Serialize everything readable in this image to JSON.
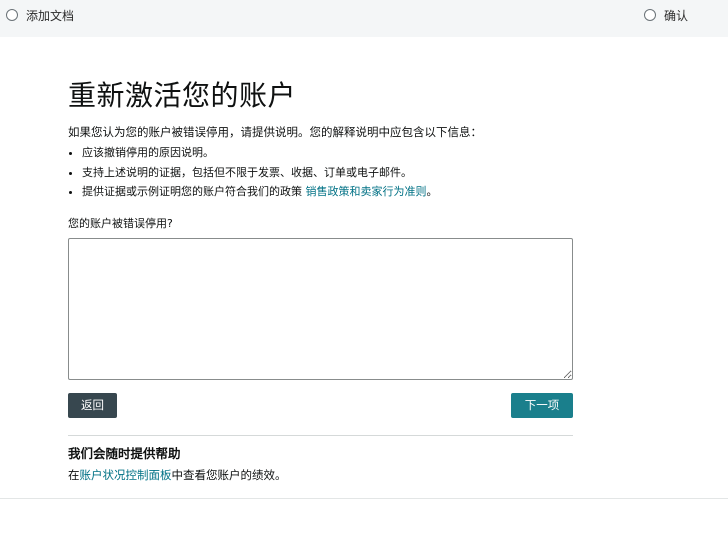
{
  "stepper": {
    "steps": [
      {
        "label": "添加文档"
      },
      {
        "label": "确认"
      }
    ]
  },
  "main": {
    "title": "重新激活您的账户",
    "intro": "如果您认为您的账户被错误停用，请提供说明。您的解释说明中应包含以下信息：",
    "reasons": [
      {
        "text": "应该撤销停用的原因说明。"
      },
      {
        "text": "支持上述说明的证据，包括但不限于发票、收据、订单或电子邮件。"
      },
      {
        "text_before": "提供证据或示例证明您的账户符合我们的政策 ",
        "link": "销售政策和卖家行为准则",
        "text_after": "。"
      }
    ],
    "question": "您的账户被错误停用?",
    "textarea_value": ""
  },
  "buttons": {
    "back": "返回",
    "next": "下一项"
  },
  "help": {
    "title": "我们会随时提供帮助",
    "text_before": "在",
    "link": "账户状况控制面板",
    "text_after": "中查看您账户的绩效。"
  },
  "colors": {
    "accent_link": "#007185",
    "next_button": "#1a7f8c",
    "back_button": "#37474f"
  }
}
